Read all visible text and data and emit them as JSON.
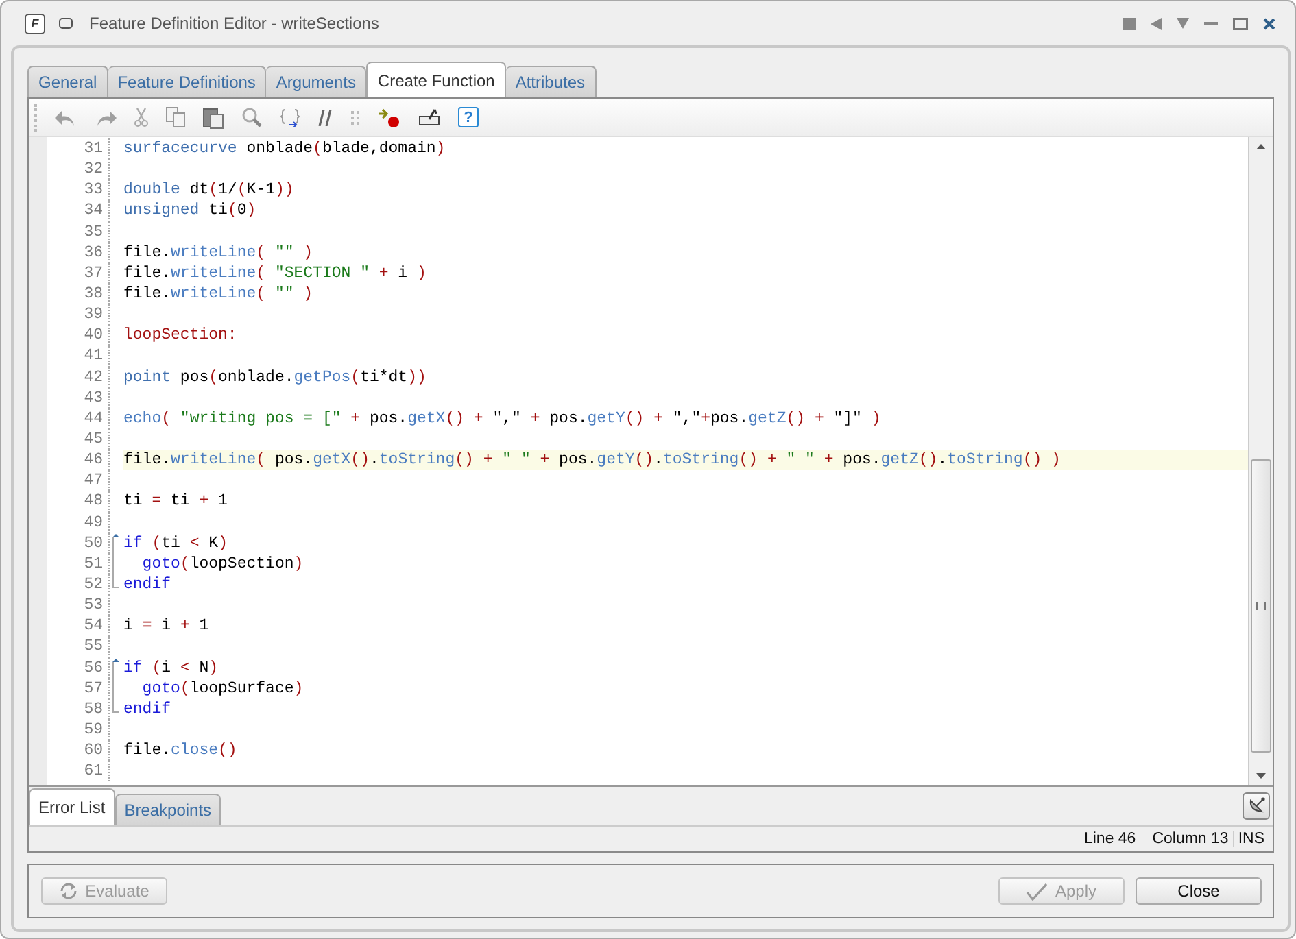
{
  "window": {
    "app_icon": "F",
    "title": "Feature Definition Editor - writeSections"
  },
  "tabs": [
    {
      "label": "General",
      "selected": false
    },
    {
      "label": "Feature Definitions",
      "selected": false
    },
    {
      "label": "Arguments",
      "selected": false
    },
    {
      "label": "Create Function",
      "selected": true
    },
    {
      "label": "Attributes",
      "selected": false
    }
  ],
  "toolbar": {
    "help_glyph": "?"
  },
  "editor": {
    "lines": [
      {
        "number": "31",
        "current": false,
        "tokens": [
          {
            "t": "surfacecurve",
            "kind": "type"
          },
          {
            "t": " onblade",
            "kind": "plain"
          },
          {
            "t": "(",
            "kind": "op"
          },
          {
            "t": "blade,domain",
            "kind": "plain"
          },
          {
            "t": ")",
            "kind": "op"
          }
        ]
      },
      {
        "number": "32",
        "current": false
      },
      {
        "number": "33",
        "current": false,
        "tokens": [
          {
            "t": "double",
            "kind": "type"
          },
          {
            "t": " dt",
            "kind": "plain"
          },
          {
            "t": "(",
            "kind": "op"
          },
          {
            "t": "1/",
            "kind": "plain"
          },
          {
            "t": "(",
            "kind": "op"
          },
          {
            "t": "K-1",
            "kind": "plain"
          },
          {
            "t": "))",
            "kind": "op"
          }
        ]
      },
      {
        "number": "34",
        "current": false,
        "tokens": [
          {
            "t": "unsigned",
            "kind": "type"
          },
          {
            "t": " ti",
            "kind": "plain"
          },
          {
            "t": "(",
            "kind": "op"
          },
          {
            "t": "0",
            "kind": "plain"
          },
          {
            "t": ")",
            "kind": "op"
          }
        ]
      },
      {
        "number": "35",
        "current": false
      },
      {
        "number": "36",
        "current": false,
        "tokens": [
          {
            "t": "file.",
            "kind": "plain"
          },
          {
            "t": "writeLine",
            "kind": "method"
          },
          {
            "t": "( ",
            "kind": "op"
          },
          {
            "t": "\"\" ",
            "kind": "str"
          },
          {
            "t": ")",
            "kind": "op"
          }
        ]
      },
      {
        "number": "37",
        "current": false,
        "tokens": [
          {
            "t": "file.",
            "kind": "plain"
          },
          {
            "t": "writeLine",
            "kind": "method"
          },
          {
            "t": "( ",
            "kind": "op"
          },
          {
            "t": "\"SECTION \" ",
            "kind": "str"
          },
          {
            "t": "+",
            "kind": "op"
          },
          {
            "t": " i ",
            "kind": "plain"
          },
          {
            "t": ")",
            "kind": "op"
          }
        ]
      },
      {
        "number": "38",
        "current": false,
        "tokens": [
          {
            "t": "file.",
            "kind": "plain"
          },
          {
            "t": "writeLine",
            "kind": "method"
          },
          {
            "t": "( ",
            "kind": "op"
          },
          {
            "t": "\"\" ",
            "kind": "str"
          },
          {
            "t": ")",
            "kind": "op"
          }
        ]
      },
      {
        "number": "39",
        "current": false
      },
      {
        "number": "40",
        "current": false,
        "tokens": [
          {
            "t": "loopSection:",
            "kind": "label"
          }
        ]
      },
      {
        "number": "41",
        "current": false
      },
      {
        "number": "42",
        "current": false,
        "tokens": [
          {
            "t": "point",
            "kind": "type"
          },
          {
            "t": " pos",
            "kind": "plain"
          },
          {
            "t": "(",
            "kind": "op"
          },
          {
            "t": "onblade.",
            "kind": "plain"
          },
          {
            "t": "getPos",
            "kind": "method"
          },
          {
            "t": "(",
            "kind": "op"
          },
          {
            "t": "ti*dt",
            "kind": "plain"
          },
          {
            "t": "))",
            "kind": "op"
          }
        ]
      },
      {
        "number": "43",
        "current": false
      },
      {
        "number": "44",
        "current": false,
        "tokens": [
          {
            "t": "echo",
            "kind": "method"
          },
          {
            "t": "( ",
            "kind": "op"
          },
          {
            "t": "\"writing pos = [\" ",
            "kind": "str"
          },
          {
            "t": "+",
            "kind": "op"
          },
          {
            "t": " pos.",
            "kind": "plain"
          },
          {
            "t": "getX",
            "kind": "method"
          },
          {
            "t": "() ",
            "kind": "op"
          },
          {
            "t": "+",
            "kind": "op"
          },
          {
            "t": " \",\" ",
            "kind": "plain"
          },
          {
            "t": "+",
            "kind": "op"
          },
          {
            "t": " pos.",
            "kind": "plain"
          },
          {
            "t": "getY",
            "kind": "method"
          },
          {
            "t": "() ",
            "kind": "op"
          },
          {
            "t": "+",
            "kind": "op"
          },
          {
            "t": " \",\"",
            "kind": "plain"
          },
          {
            "t": "+",
            "kind": "op"
          },
          {
            "t": "pos.",
            "kind": "plain"
          },
          {
            "t": "getZ",
            "kind": "method"
          },
          {
            "t": "() ",
            "kind": "op"
          },
          {
            "t": "+",
            "kind": "op"
          },
          {
            "t": " \"]\" ",
            "kind": "plain"
          },
          {
            "t": ")",
            "kind": "op"
          }
        ]
      },
      {
        "number": "45",
        "current": false
      },
      {
        "number": "46",
        "current": true,
        "tokens": [
          {
            "t": "file.",
            "kind": "plain"
          },
          {
            "t": "writeLine",
            "kind": "method"
          },
          {
            "t": "(",
            "kind": "op"
          },
          {
            "t": " pos.",
            "kind": "plain"
          },
          {
            "t": "getX",
            "kind": "method"
          },
          {
            "t": "()",
            "kind": "op"
          },
          {
            "t": ".",
            "kind": "plain"
          },
          {
            "t": "toString",
            "kind": "method"
          },
          {
            "t": "() ",
            "kind": "op"
          },
          {
            "t": "+ ",
            "kind": "op"
          },
          {
            "t": "\" \" ",
            "kind": "str"
          },
          {
            "t": "+",
            "kind": "op"
          },
          {
            "t": " pos.",
            "kind": "plain"
          },
          {
            "t": "getY",
            "kind": "method"
          },
          {
            "t": "()",
            "kind": "op"
          },
          {
            "t": ".",
            "kind": "plain"
          },
          {
            "t": "toString",
            "kind": "method"
          },
          {
            "t": "() ",
            "kind": "op"
          },
          {
            "t": "+ ",
            "kind": "op"
          },
          {
            "t": "\" \" ",
            "kind": "str"
          },
          {
            "t": "+",
            "kind": "op"
          },
          {
            "t": " pos.",
            "kind": "plain"
          },
          {
            "t": "getZ",
            "kind": "method"
          },
          {
            "t": "()",
            "kind": "op"
          },
          {
            "t": ".",
            "kind": "plain"
          },
          {
            "t": "toString",
            "kind": "method"
          },
          {
            "t": "() )",
            "kind": "op"
          }
        ]
      },
      {
        "number": "47",
        "current": false
      },
      {
        "number": "48",
        "current": false,
        "tokens": [
          {
            "t": "ti ",
            "kind": "plain"
          },
          {
            "t": "=",
            "kind": "op"
          },
          {
            "t": " ti ",
            "kind": "plain"
          },
          {
            "t": "+",
            "kind": "op"
          },
          {
            "t": " 1",
            "kind": "plain"
          }
        ]
      },
      {
        "number": "49",
        "current": false
      },
      {
        "number": "50",
        "current": false,
        "kind": "foldstart",
        "tokens": [
          {
            "t": "if ",
            "kind": "kw"
          },
          {
            "t": "(",
            "kind": "op"
          },
          {
            "t": "ti ",
            "kind": "plain"
          },
          {
            "t": "<",
            "kind": "op"
          },
          {
            "t": " K",
            "kind": "plain"
          },
          {
            "t": ")",
            "kind": "op"
          }
        ]
      },
      {
        "number": "51",
        "current": false,
        "kind": "foldbody",
        "tokens": [
          {
            "t": "  goto",
            "kind": "kw"
          },
          {
            "t": "(",
            "kind": "op"
          },
          {
            "t": "loopSection",
            "kind": "plain"
          },
          {
            "t": ")",
            "kind": "op"
          }
        ]
      },
      {
        "number": "52",
        "current": false,
        "kind": "foldend",
        "tokens": [
          {
            "t": "endif",
            "kind": "kw"
          }
        ]
      },
      {
        "number": "53",
        "current": false
      },
      {
        "number": "54",
        "current": false,
        "tokens": [
          {
            "t": "i ",
            "kind": "plain"
          },
          {
            "t": "=",
            "kind": "op"
          },
          {
            "t": " i ",
            "kind": "plain"
          },
          {
            "t": "+",
            "kind": "op"
          },
          {
            "t": " 1",
            "kind": "plain"
          }
        ]
      },
      {
        "number": "55",
        "current": false
      },
      {
        "number": "56",
        "current": false,
        "kind": "foldstart",
        "tokens": [
          {
            "t": "if ",
            "kind": "kw"
          },
          {
            "t": "(",
            "kind": "op"
          },
          {
            "t": "i ",
            "kind": "plain"
          },
          {
            "t": "<",
            "kind": "op"
          },
          {
            "t": " N",
            "kind": "plain"
          },
          {
            "t": ")",
            "kind": "op"
          }
        ]
      },
      {
        "number": "57",
        "current": false,
        "kind": "foldbody",
        "tokens": [
          {
            "t": "  goto",
            "kind": "kw"
          },
          {
            "t": "(",
            "kind": "op"
          },
          {
            "t": "loopSurface",
            "kind": "plain"
          },
          {
            "t": ")",
            "kind": "op"
          }
        ]
      },
      {
        "number": "58",
        "current": false,
        "kind": "foldend",
        "tokens": [
          {
            "t": "endif",
            "kind": "kw"
          }
        ]
      },
      {
        "number": "59",
        "current": false
      },
      {
        "number": "60",
        "current": false,
        "tokens": [
          {
            "t": "file.",
            "kind": "plain"
          },
          {
            "t": "close",
            "kind": "method"
          },
          {
            "t": "()",
            "kind": "op"
          }
        ]
      },
      {
        "number": "61",
        "current": false
      }
    ]
  },
  "bottom_tabs": [
    {
      "label": "Error List",
      "selected": true
    },
    {
      "label": "Breakpoints",
      "selected": false
    }
  ],
  "status_bar": [
    "Line 46",
    "Column 13",
    "INS"
  ],
  "buttons": [
    {
      "label": "Evaluate",
      "kind": "refresh",
      "disabled": true
    },
    {
      "label": "Apply",
      "kind": "check",
      "disabled": true
    },
    {
      "label": "Close",
      "kind": "text",
      "disabled": false
    }
  ]
}
